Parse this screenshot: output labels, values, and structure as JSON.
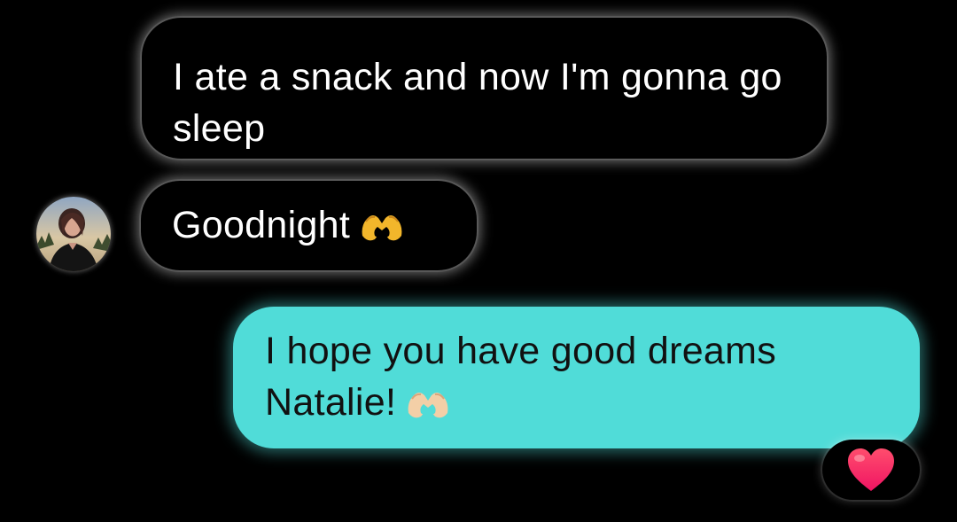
{
  "conversation": {
    "contact_avatar_icon": "contact-avatar-photo",
    "messages": [
      {
        "direction": "incoming",
        "text": "I ate a snack and now I'm gonna go sleep"
      },
      {
        "direction": "incoming",
        "text": "Goodnight",
        "emoji": "heart-hands-emoji"
      },
      {
        "direction": "outgoing",
        "text": "I hope you have good dreams Natalie!",
        "emoji": "heart-hands-emoji",
        "reaction": "red-heart-emoji"
      }
    ]
  },
  "colors": {
    "background": "#000000",
    "incoming_bubble": "#000000",
    "outgoing_bubble": "#50dcd8",
    "reaction_heart": "#ff2d55"
  }
}
